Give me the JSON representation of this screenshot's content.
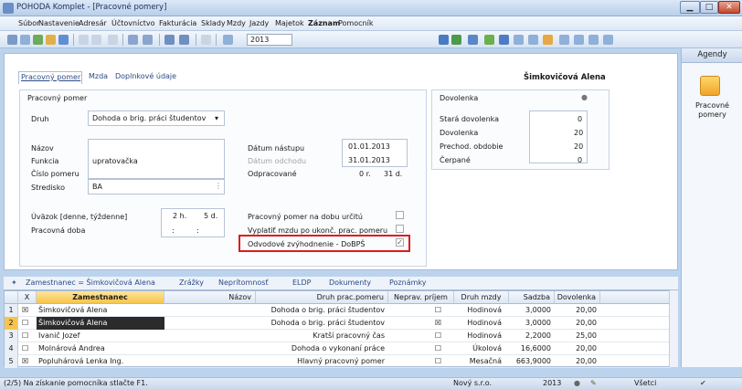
{
  "window": {
    "title": "POHODA Komplet - [Pracovné pomery]",
    "min": "▁",
    "max": "□",
    "close": "✕"
  },
  "menu": [
    "Súbor",
    "Nastavenie",
    "Adresár",
    "Účtovníctvo",
    "Fakturácia",
    "Sklady",
    "Mzdy",
    "Jazdy",
    "Majetok",
    "Záznam",
    "Pomocník"
  ],
  "toolbar": {
    "year": "2013"
  },
  "agenda": {
    "title": "Agendy",
    "item": "Pracovné pomery"
  },
  "tabs": [
    "Pracovný pomer",
    "Mzda",
    "Doplnkové údaje"
  ],
  "employee_name": "Šimkovičová Alena",
  "form": {
    "group_title": "Pracovný pomer",
    "druh_label": "Druh",
    "druh_value": "Dohoda o brig. práci študentov",
    "nazov_label": "Názov",
    "funkcia_label": "Funkcia",
    "funkcia_value": "upratovačka",
    "cislo_label": "Číslo pomeru",
    "stredisko_label": "Stredisko",
    "stredisko_value": "BA",
    "datum_nastupu_label": "Dátum nástupu",
    "datum_nastupu_value": "01.01.2013",
    "datum_odchodu_label": "Dátum odchodu",
    "datum_odchodu_value": "31.01.2013",
    "odpracovane_label": "Odpracované",
    "odpracovane_r": "0 r.",
    "odpracovane_d": "31 d.",
    "uvazok_label": "Úväzok [denne, týždenne]",
    "uvazok_h": "2 h.",
    "uvazok_d": "5 d.",
    "pracovna_doba_label": "Pracovná doba",
    "colon": ":",
    "urcity_label": "Pracovný pomer na dobu určitú",
    "vyplatit_label": "Vyplatiť mzdu po ukonč. prac. pomeru",
    "odvodove_label": "Odvodové zvýhodnenie - DoBPŠ",
    "check_mark": "✓"
  },
  "dovolenka": {
    "title": "Dovolenka",
    "stara_label": "Stará dovolenka",
    "stara_value": "0",
    "dovolenka_label": "Dovolenka",
    "dovolenka_value": "20",
    "prechod_label": "Prechod. obdobie",
    "prechod_value": "20",
    "cerpane_label": "Čerpané",
    "cerpane_value": "0"
  },
  "bottom_tabs": [
    "Zamestnanec = Šimkovičová Alena",
    "Zrážky",
    "Neprítomnosť",
    "ELDP",
    "Dokumenty",
    "Poznámky"
  ],
  "table": {
    "headers": [
      "X",
      "Zamestnanec",
      "Názov",
      "Druh prac.pomeru",
      "Neprav. príjem",
      "Druh mzdy",
      "Sadzba",
      "Dovolenka"
    ],
    "rows": [
      {
        "num": "1",
        "x": "☒",
        "name": "Šimkovičová Alena",
        "druh": "Dohoda o brig. práci študentov",
        "neprav": "☐",
        "mzda": "Hodinová",
        "sadzba": "3,0000",
        "dovolenka": "20,00"
      },
      {
        "num": "2",
        "x": "☐",
        "name": "Šimkovičová Alena",
        "druh": "Dohoda o brig. práci študentov",
        "neprav": "☒",
        "mzda": "Hodinová",
        "sadzba": "3,0000",
        "dovolenka": "20,00"
      },
      {
        "num": "3",
        "x": "☐",
        "name": "Ivanič Jozef",
        "druh": "Kratší pracovný čas",
        "neprav": "☐",
        "mzda": "Hodinová",
        "sadzba": "2,2000",
        "dovolenka": "25,00"
      },
      {
        "num": "4",
        "x": "☐",
        "name": "Molnárová Andrea",
        "druh": "Dohoda o vykonaní práce",
        "neprav": "☐",
        "mzda": "Úkolová",
        "sadzba": "16,6000",
        "dovolenka": "20,00"
      },
      {
        "num": "5",
        "x": "☒",
        "name": "Popluhárová Lenka Ing.",
        "druh": "Hlavný pracovný pomer",
        "neprav": "☐",
        "mzda": "Mesačná",
        "sadzba": "663,9000",
        "dovolenka": "20,00"
      }
    ]
  },
  "status": {
    "help": "(2/5) Na získanie pomocníka stlačte F1.",
    "company": "Nový s.r.o.",
    "year": "2013",
    "filter": "Všetci"
  },
  "colors": {
    "accent": "#f6c44c",
    "highlight": "#e01b1b"
  }
}
